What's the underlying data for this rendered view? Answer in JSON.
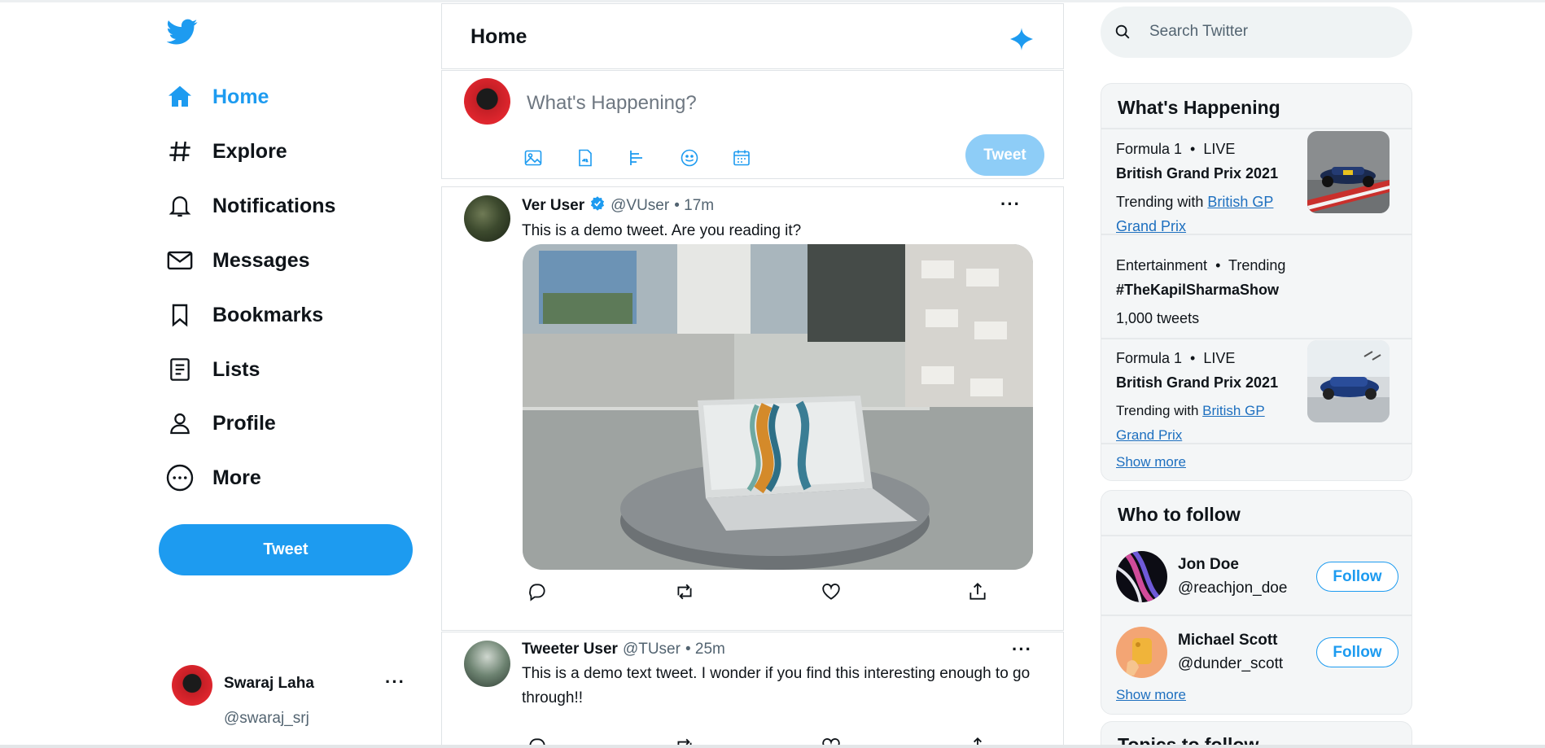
{
  "sidebar": {
    "logo": "twitter-bird-icon",
    "nav": [
      {
        "label": "Home",
        "icon": "home-icon",
        "active": true
      },
      {
        "label": "Explore",
        "icon": "hashtag-icon"
      },
      {
        "label": "Notifications",
        "icon": "bell-icon"
      },
      {
        "label": "Messages",
        "icon": "mail-icon"
      },
      {
        "label": "Bookmarks",
        "icon": "bookmark-icon"
      },
      {
        "label": "Lists",
        "icon": "list-icon"
      },
      {
        "label": "Profile",
        "icon": "person-icon"
      },
      {
        "label": "More",
        "icon": "more-circle-icon"
      }
    ],
    "tweet_button": "Tweet",
    "account": {
      "name": "Swaraj Laha",
      "handle": "@swaraj_srj",
      "more": "···"
    }
  },
  "main": {
    "title": "Home",
    "composer": {
      "placeholder": "What's Happening?",
      "tweet_button": "Tweet"
    },
    "tweets": [
      {
        "user": "Ver User",
        "verified": true,
        "handle": "@VUser",
        "time": "• 17m",
        "text": "This is a demo tweet. Are you reading it?",
        "more": "···"
      },
      {
        "user": "Tweeter User",
        "verified": false,
        "handle": "@TUser",
        "time": "• 25m",
        "text": "This is a demo text tweet. I wonder if you find this interesting enough to go through!!",
        "more": "···"
      }
    ]
  },
  "right": {
    "search": {
      "placeholder": "Search Twitter"
    },
    "happening": {
      "title": "What's Happening",
      "trends": [
        {
          "category": "Formula 1",
          "status": "LIVE",
          "title": "British Grand Prix 2021",
          "sub_prefix": "Trending with",
          "sub_link": "British GP Grand Prix"
        },
        {
          "category": "Entertainment",
          "status": "Trending",
          "title": "#TheKapilSharmaShow",
          "sub_prefix": "1,000 tweets",
          "sub_link": ""
        },
        {
          "category": "Formula 1",
          "status": "LIVE",
          "title": "British Grand Prix 2021",
          "sub_prefix": "Trending with",
          "sub_link": "British GP Grand Prix"
        }
      ],
      "show_more": "Show more"
    },
    "who_to_follow": {
      "title": "Who to follow",
      "users": [
        {
          "name": "Jon Doe",
          "handle": "@reachjon_doe",
          "button": "Follow"
        },
        {
          "name": "Michael Scott",
          "handle": "@dunder_scott",
          "button": "Follow"
        }
      ],
      "show_more": "Show more"
    },
    "topics": {
      "title": "Topics to follow"
    }
  },
  "colors": {
    "accent": "#1d9bf0",
    "accent_disabled": "#8ecdf7",
    "link": "#1d6fbf"
  }
}
